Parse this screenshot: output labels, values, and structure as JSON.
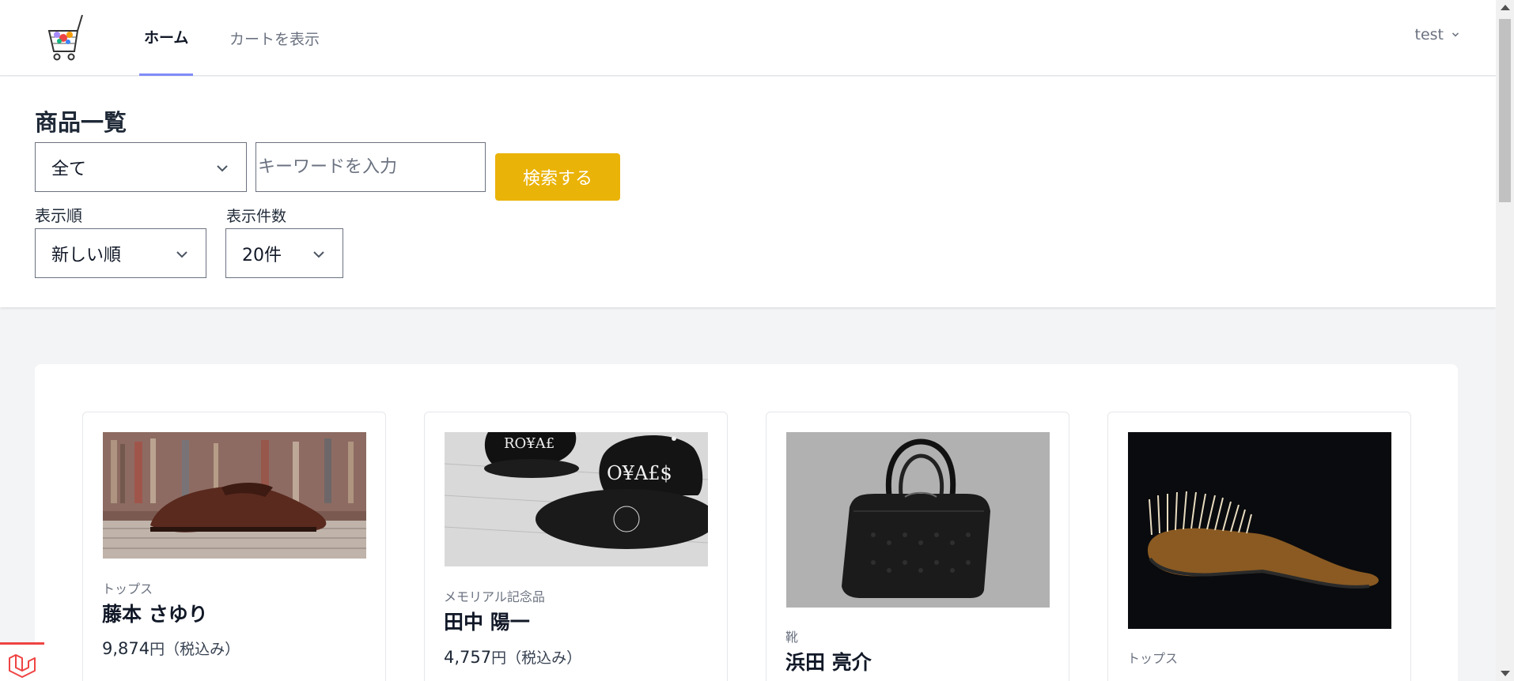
{
  "nav": {
    "logo_icon": "shopping-cart-logo",
    "tabs": [
      {
        "label": "ホーム",
        "active": true
      },
      {
        "label": "カートを表示",
        "active": false
      }
    ],
    "user": "test"
  },
  "header": {
    "title": "商品一覧",
    "category_select": "全て",
    "keyword_placeholder": "キーワードを入力",
    "keyword_value": "",
    "search_button": "検索する",
    "sort_label": "表示順",
    "sort_select": "新しい順",
    "count_label": "表示件数",
    "count_select": "20件"
  },
  "products": [
    {
      "category": "トップス",
      "name": "藤本 さゆり",
      "price": "9,874",
      "currency": "円",
      "tax_note": "（税込み）",
      "image": "shoe-photo"
    },
    {
      "category": "メモリアル記念品",
      "name": "田中 陽一",
      "price": "4,757",
      "currency": "円",
      "tax_note": "（税込み）",
      "image": "caps-photo"
    },
    {
      "category": "靴",
      "name": "浜田 亮介",
      "image": "handbag-photo"
    },
    {
      "category": "トップス",
      "name": "",
      "image": "brush-photo"
    }
  ],
  "colors": {
    "accent": "#eab308",
    "tab_underline": "#818cf8",
    "badge": "#ef4444"
  }
}
